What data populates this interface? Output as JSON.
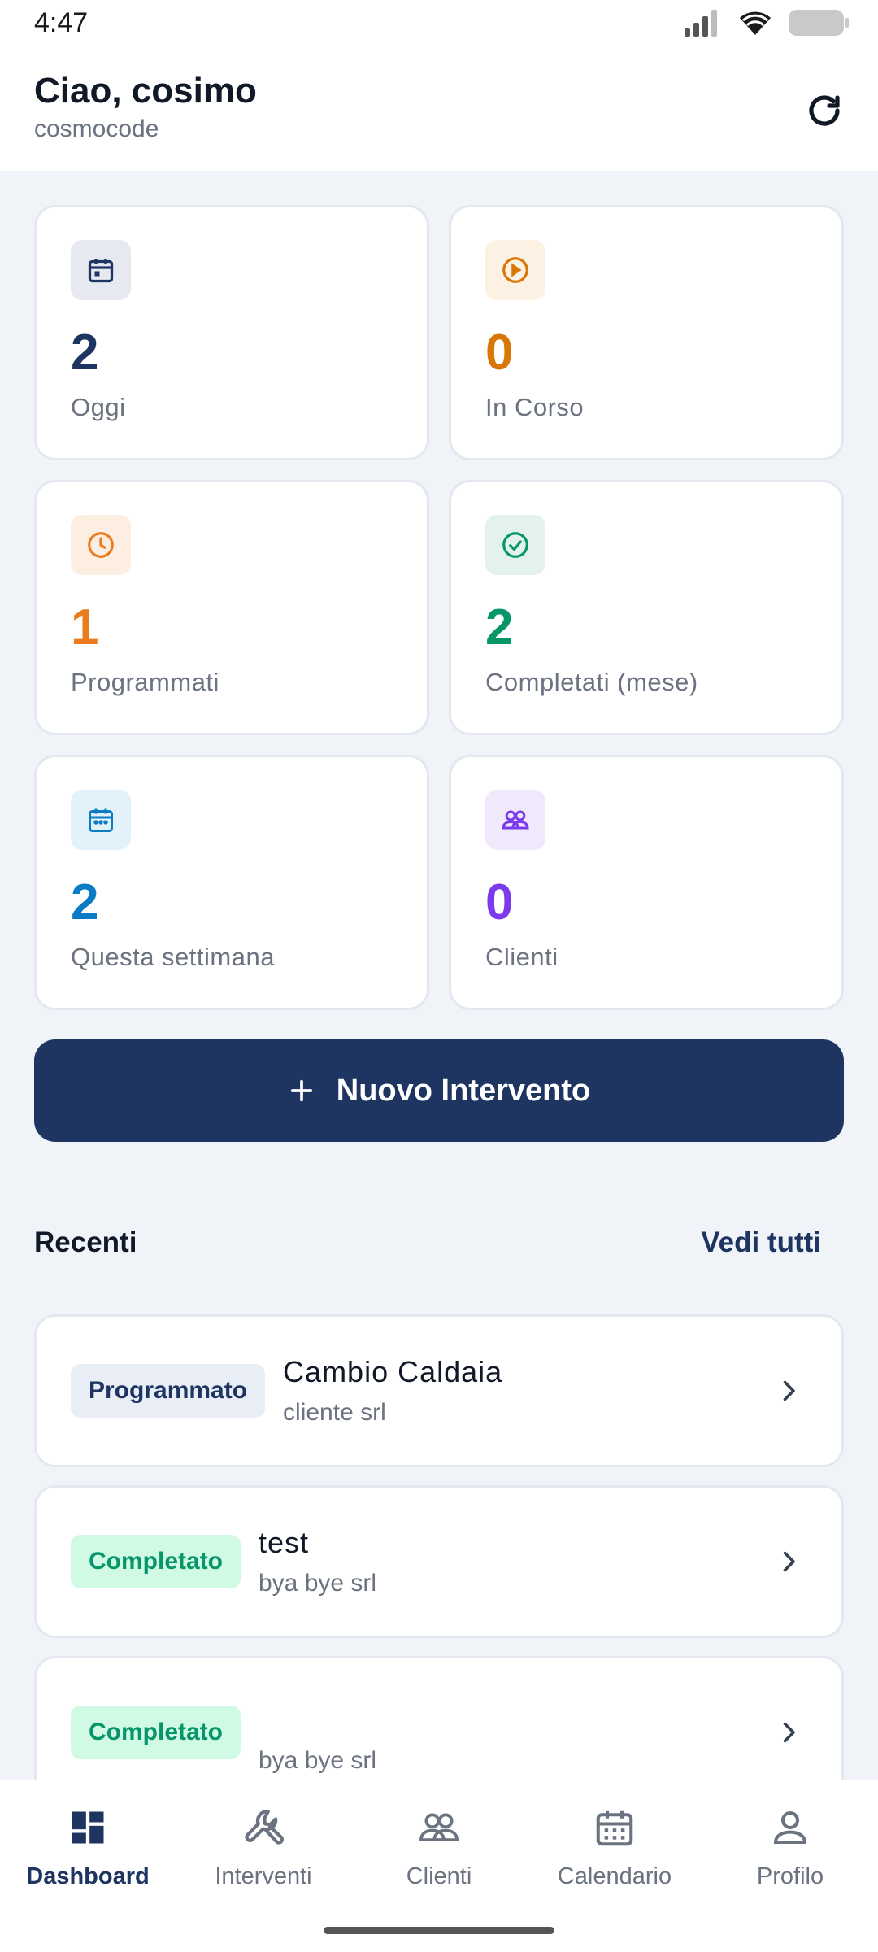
{
  "status_bar": {
    "time": "4:47"
  },
  "header": {
    "greeting": "Ciao, cosimo",
    "username": "cosmocode"
  },
  "stats": [
    {
      "value": "2",
      "label": "Oggi",
      "icon": "calendar-icon",
      "color": "#1e3461",
      "icon_bg": "#e6eaf0"
    },
    {
      "value": "0",
      "label": "In Corso",
      "icon": "play-circle-icon",
      "color": "#d97706",
      "icon_bg": "#fdf1e4"
    },
    {
      "value": "1",
      "label": "Programmati",
      "icon": "clock-icon",
      "color": "#ea7c1f",
      "icon_bg": "#fdeee2"
    },
    {
      "value": "2",
      "label": "Completati (mese)",
      "icon": "check-circle-icon",
      "color": "#079669",
      "icon_bg": "#e3f3ec"
    },
    {
      "value": "2",
      "label": "Questa settimana",
      "icon": "calendar-week-icon",
      "color": "#0b7bc4",
      "icon_bg": "#e3f1fa"
    },
    {
      "value": "0",
      "label": "Clienti",
      "icon": "users-icon",
      "color": "#7c3aed",
      "icon_bg": "#f0e9fc"
    }
  ],
  "new_button": {
    "label": "Nuovo Intervento"
  },
  "recent": {
    "title": "Recenti",
    "see_all": "Vedi tutti",
    "items": [
      {
        "status": "Programmato",
        "title": "Cambio Caldaia",
        "client": "cliente srl"
      },
      {
        "status": "Completato",
        "title": "test",
        "client": "bya bye srl"
      },
      {
        "status": "Completato",
        "title": "",
        "client": "bya bye srl"
      }
    ]
  },
  "nav": [
    {
      "label": "Dashboard",
      "icon": "dashboard-icon",
      "active": true
    },
    {
      "label": "Interventi",
      "icon": "wrench-icon",
      "active": false
    },
    {
      "label": "Clienti",
      "icon": "users-icon",
      "active": false
    },
    {
      "label": "Calendario",
      "icon": "calendar-icon",
      "active": false
    },
    {
      "label": "Profilo",
      "icon": "person-icon",
      "active": false
    }
  ],
  "colors": {
    "primary": "#1e3461",
    "background": "#f0f4f9"
  }
}
